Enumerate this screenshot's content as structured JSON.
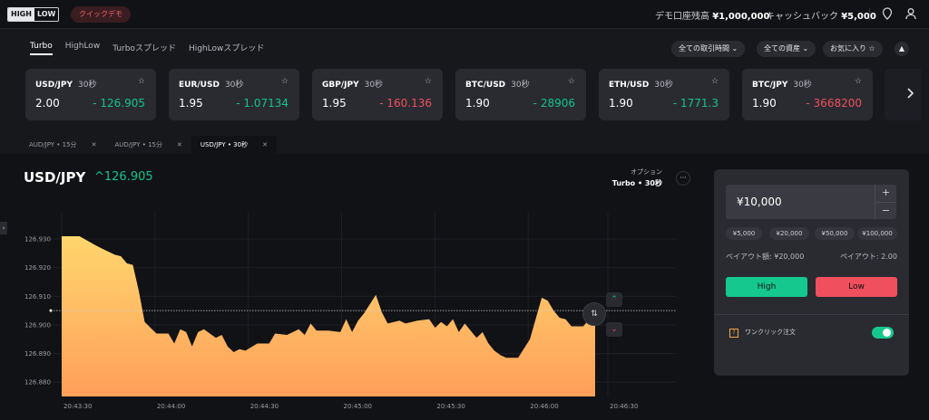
{
  "header": {
    "logo_top": "HIGH",
    "logo_bottom": "LOW",
    "demo_badge": "クイックデモ",
    "balance_label": "デモ口座残高",
    "balance_value": "¥1,000,000",
    "cashback_label": "キャッシュバック",
    "cashback_value": "¥5,000"
  },
  "asset_tabs": [
    "Turbo",
    "HighLow",
    "Turboスプレッド",
    "HighLowスプレッド"
  ],
  "filters": {
    "time": "全ての取引時間 ⌄",
    "assets": "全ての資産 ⌄",
    "favorites": "お気に入り ☆"
  },
  "cards": [
    {
      "symbol": "USD/JPY",
      "duration": "30秒",
      "payout": "2.00",
      "rate": "- 126.905",
      "direction": "up"
    },
    {
      "symbol": "EUR/USD",
      "duration": "30秒",
      "payout": "1.95",
      "rate": "- 1.07134",
      "direction": "up"
    },
    {
      "symbol": "GBP/JPY",
      "duration": "30秒",
      "payout": "1.95",
      "rate": "- 160.136",
      "direction": "down"
    },
    {
      "symbol": "BTC/USD",
      "duration": "30秒",
      "payout": "1.90",
      "rate": "- 28906",
      "direction": "up"
    },
    {
      "symbol": "ETH/USD",
      "duration": "30秒",
      "payout": "1.90",
      "rate": "- 1771.3",
      "direction": "up"
    },
    {
      "symbol": "BTC/JPY",
      "duration": "30秒",
      "payout": "1.90",
      "rate": "- 3668200",
      "direction": "down"
    }
  ],
  "chart_tabs": [
    {
      "label": "AUD/JPY • 15分",
      "active": false
    },
    {
      "label": "AUD/JPY • 15分",
      "active": false
    },
    {
      "label": "USD/JPY • 30秒",
      "active": true
    }
  ],
  "chart_header": {
    "symbol": "USD/JPY",
    "rate": "^126.905",
    "option_label": "オプション",
    "option_value": "Turbo • 30秒"
  },
  "chart_data": {
    "type": "area",
    "x_labels": [
      "20:43:30",
      "20:44:00",
      "20:44:30",
      "20:45:00",
      "20:45:30",
      "20:46:00",
      "20:46:30"
    ],
    "y_ticks": [
      126.93,
      126.92,
      126.91,
      126.9,
      126.89,
      126.88
    ],
    "ylim": [
      126.875,
      126.937
    ],
    "current_rate": 126.905,
    "grid": true,
    "series": [
      {
        "x": [
          0,
          3,
          6,
          7,
          9,
          10,
          11,
          12,
          13,
          14,
          16,
          18,
          19,
          20,
          21,
          22,
          23,
          24,
          26,
          27,
          28,
          29,
          30,
          31,
          33,
          35,
          36,
          38,
          40,
          41,
          42,
          43,
          45,
          47,
          48,
          49,
          50,
          51,
          53,
          54,
          55,
          57,
          58,
          60,
          62,
          63,
          64,
          65,
          66,
          67,
          68,
          70,
          71,
          72,
          73,
          74,
          75,
          77,
          79,
          81,
          82,
          83,
          84,
          85,
          86,
          87,
          88,
          89,
          90
        ],
        "y": [
          126.931,
          126.931,
          126.9275,
          126.9265,
          126.9245,
          126.924,
          126.9215,
          126.921,
          126.912,
          126.901,
          126.897,
          126.897,
          126.8935,
          126.8985,
          126.8975,
          126.8925,
          126.8975,
          126.8985,
          126.8955,
          126.8965,
          126.8925,
          126.8905,
          126.8915,
          126.891,
          126.8935,
          126.8935,
          126.897,
          126.8965,
          126.8985,
          126.8965,
          126.9005,
          126.898,
          126.898,
          126.8975,
          126.902,
          126.8975,
          126.9015,
          126.904,
          126.9105,
          126.9045,
          126.9005,
          126.9015,
          126.9005,
          126.9015,
          126.902,
          126.899,
          126.901,
          126.8995,
          126.902,
          126.8975,
          126.9005,
          126.8955,
          126.8975,
          126.8935,
          126.891,
          126.8895,
          126.8885,
          126.8885,
          126.895,
          126.9095,
          126.9085,
          126.905,
          126.9025,
          126.902,
          126.8995,
          126.8995,
          126.8995,
          126.902,
          126.905
        ]
      }
    ]
  },
  "trade_panel": {
    "amount": "¥10,000",
    "presets": [
      "¥5,000",
      "¥20,000",
      "¥50,000",
      "¥100,000"
    ],
    "payout_amount": "ペイアウト額: ¥20,000",
    "payout_rate": "ペイアウト: 2.00",
    "high_label": "High",
    "low_label": "Low",
    "one_click_label": "ワンクリック注文",
    "one_click_enabled": true
  },
  "colors": {
    "up": "#12c48b",
    "down": "#f04f5d",
    "area_top": "#ffd66e",
    "area_bottom": "#ff9f5a"
  }
}
